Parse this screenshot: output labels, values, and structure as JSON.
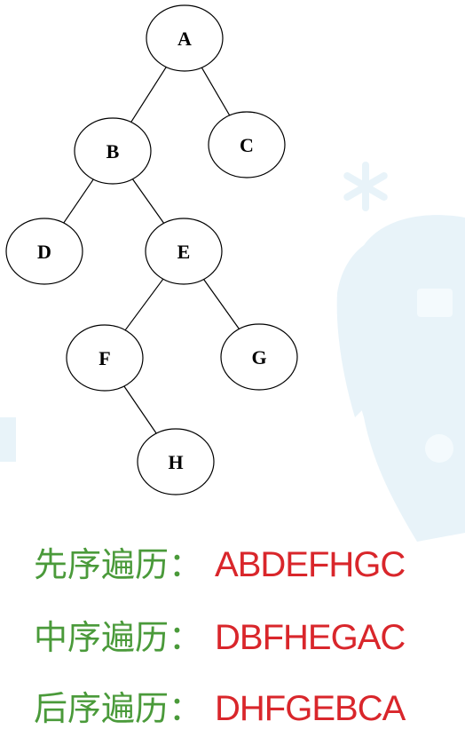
{
  "tree": {
    "nodes": [
      {
        "id": "A",
        "label": "A"
      },
      {
        "id": "B",
        "label": "B"
      },
      {
        "id": "C",
        "label": "C"
      },
      {
        "id": "D",
        "label": "D"
      },
      {
        "id": "E",
        "label": "E"
      },
      {
        "id": "F",
        "label": "F"
      },
      {
        "id": "G",
        "label": "G"
      },
      {
        "id": "H",
        "label": "H"
      }
    ],
    "edges": [
      {
        "from": "A",
        "to": "B"
      },
      {
        "from": "A",
        "to": "C"
      },
      {
        "from": "B",
        "to": "D"
      },
      {
        "from": "B",
        "to": "E"
      },
      {
        "from": "E",
        "to": "F"
      },
      {
        "from": "E",
        "to": "G"
      },
      {
        "from": "F",
        "to": "H"
      }
    ]
  },
  "traversals": [
    {
      "name": "先序遍历：",
      "sequence": "ABDEFHGC"
    },
    {
      "name": "中序遍历：",
      "sequence": "DBFHEGAC"
    },
    {
      "name": "后序遍历：",
      "sequence": "DHFGEBCA"
    }
  ],
  "colors": {
    "label": "#4a9a3a",
    "sequence": "#d9262b",
    "watermark": "#e6f2f8"
  }
}
